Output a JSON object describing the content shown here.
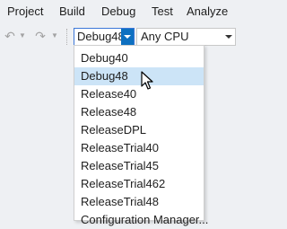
{
  "menubar": {
    "items": [
      "Project",
      "Build",
      "Debug",
      "Test",
      "Analyze"
    ]
  },
  "toolbar": {
    "undo_icon": "undo-icon",
    "redo_icon": "redo-icon",
    "dropdown_arrow_icon": "chevron-down-icon",
    "configuration_value": "Debug48",
    "platform_value": "Any CPU"
  },
  "dropdown": {
    "highlighted_index": 1,
    "items": [
      "Debug40",
      "Debug48",
      "Release40",
      "Release48",
      "ReleaseDPL",
      "ReleaseTrial40",
      "ReleaseTrial45",
      "ReleaseTrial462",
      "ReleaseTrial48",
      "Configuration Manager..."
    ]
  },
  "colors": {
    "background": "#eef0f3",
    "accent": "#0e70c0",
    "highlight": "#cce4f7"
  }
}
